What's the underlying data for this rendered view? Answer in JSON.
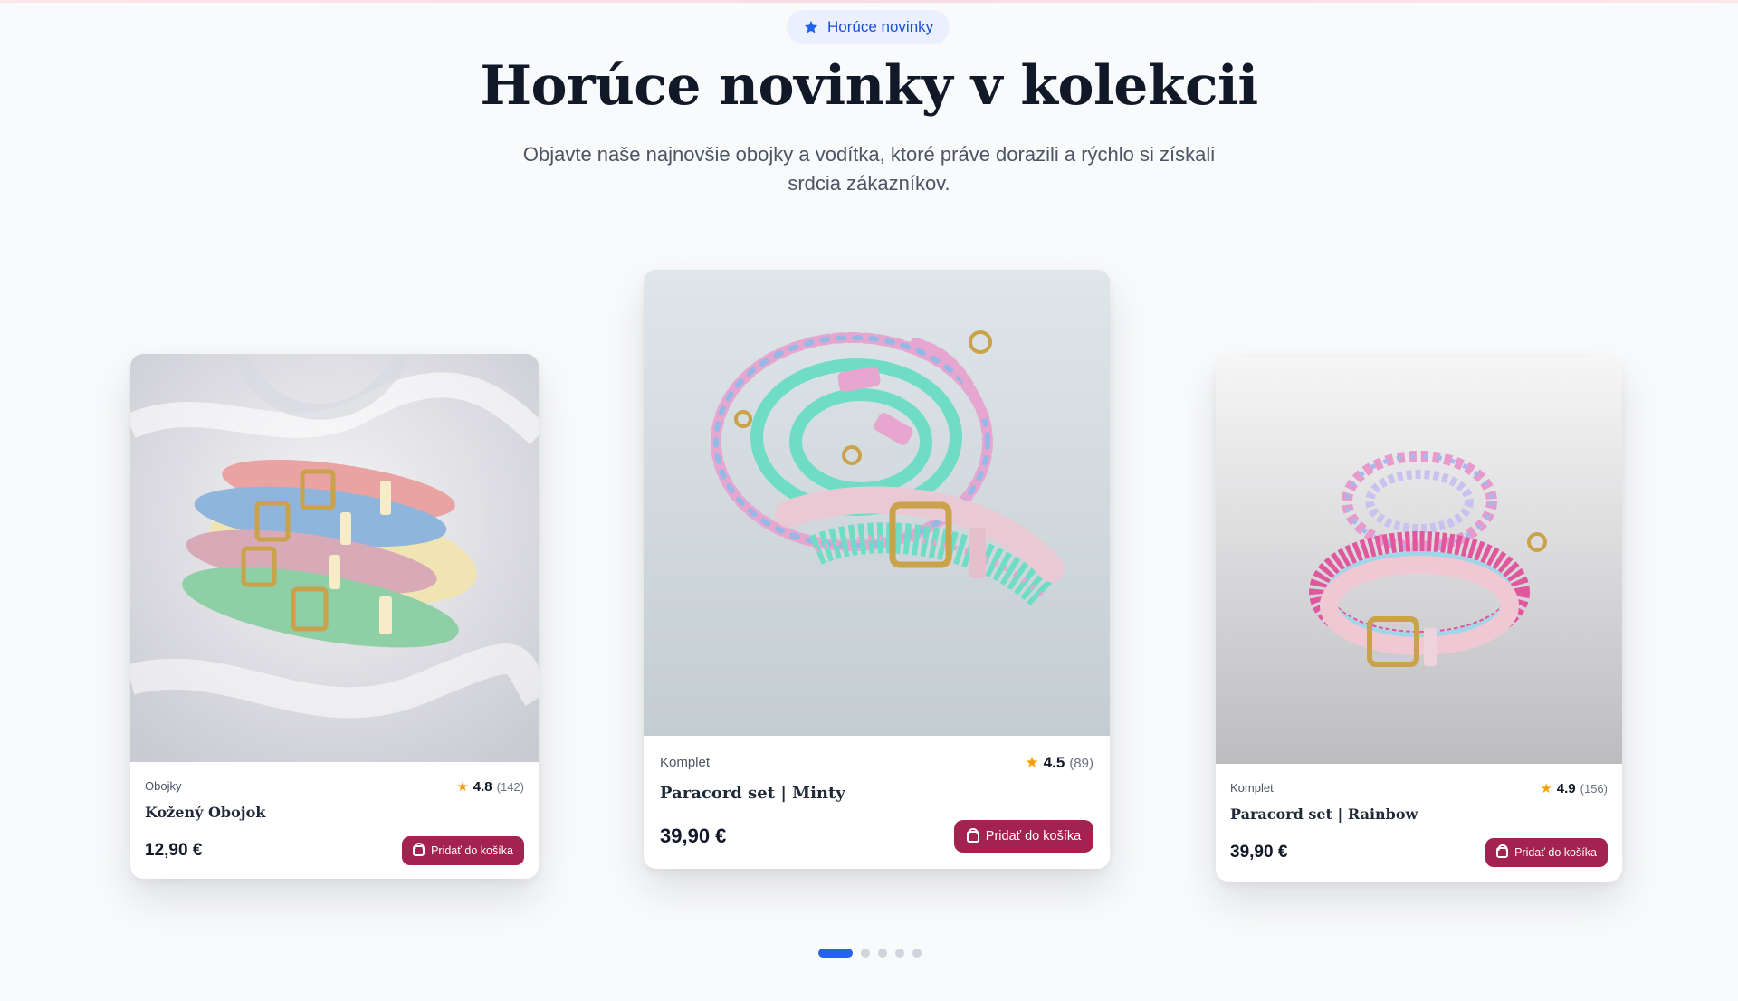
{
  "section": {
    "badge": "Horúce novinky",
    "title": "Horúce novinky v kolekcii",
    "subtitle": "Objavte naše najnovšie obojky a vodítka, ktoré práve dorazili a rýchlo si získali srdcia zákazníkov."
  },
  "products": [
    {
      "category": "Obojky",
      "rating": "4.8",
      "reviews": "(142)",
      "name": "Kožený Obojok",
      "price": "12,90 €",
      "button": "Pridať do košíka",
      "image": "leather-collars-photo"
    },
    {
      "category": "Komplet",
      "rating": "4.5",
      "reviews": "(89)",
      "name": "Paracord set | Minty",
      "price": "39,90 €",
      "button": "Pridať do košíka",
      "image": "paracord-minty-set-photo"
    },
    {
      "category": "Komplet",
      "rating": "4.9",
      "reviews": "(156)",
      "name": "Paracord set | Rainbow",
      "price": "39,90 €",
      "button": "Pridať do košíka",
      "image": "paracord-rainbow-set-photo"
    }
  ],
  "carousel": {
    "slides": 5,
    "active": 1
  },
  "colors": {
    "accent_blue": "#2563eb",
    "button": "#a3224f",
    "star": "#f59e0b",
    "badge_bg": "#eaf0fd"
  }
}
